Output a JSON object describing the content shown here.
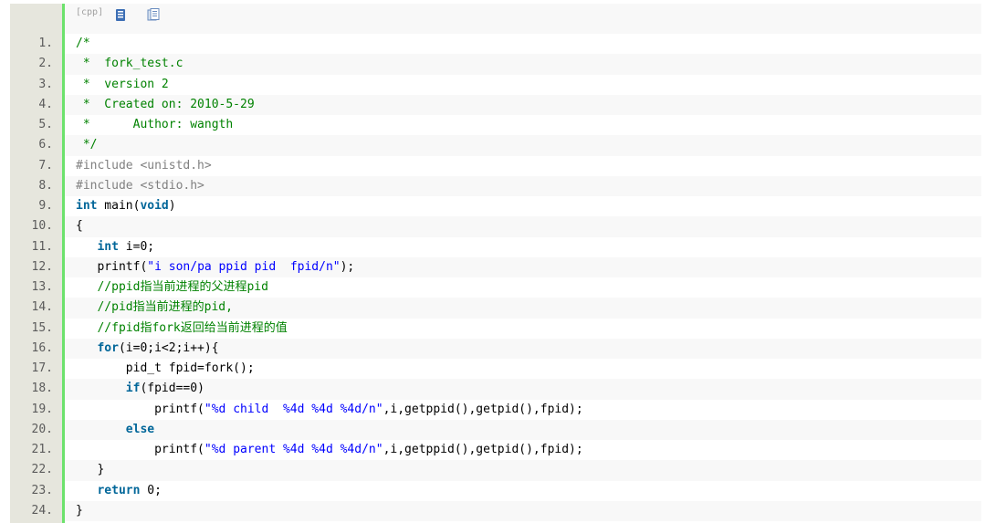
{
  "toolbar": {
    "language": "[cpp]",
    "view_icon": "view-source-icon",
    "copy_icon": "copy-to-clipboard-icon"
  },
  "colors": {
    "gutter": "#e6e6dd",
    "accent_bar": "#6ce26c",
    "comment": "#008200",
    "keyword": "#006699",
    "string": "#0000ff",
    "preprocessor": "#808080"
  },
  "lines": [
    {
      "num": "1.",
      "tokens": [
        {
          "t": "/*",
          "c": "comment"
        }
      ]
    },
    {
      "num": "2.",
      "tokens": [
        {
          "t": " *  fork_test.c",
          "c": "comment"
        }
      ]
    },
    {
      "num": "3.",
      "tokens": [
        {
          "t": " *  version 2",
          "c": "comment"
        }
      ]
    },
    {
      "num": "4.",
      "tokens": [
        {
          "t": " *  Created on: 2010-5-29",
          "c": "comment"
        }
      ]
    },
    {
      "num": "5.",
      "tokens": [
        {
          "t": " *      Author: wangth",
          "c": "comment"
        }
      ]
    },
    {
      "num": "6.",
      "tokens": [
        {
          "t": " */",
          "c": "comment"
        }
      ]
    },
    {
      "num": "7.",
      "tokens": [
        {
          "t": "#include <unistd.h>",
          "c": "pre"
        }
      ]
    },
    {
      "num": "8.",
      "tokens": [
        {
          "t": "#include <stdio.h>",
          "c": "pre"
        }
      ]
    },
    {
      "num": "9.",
      "tokens": [
        {
          "t": "int",
          "c": "kw"
        },
        {
          "t": " main(",
          "c": "plain"
        },
        {
          "t": "void",
          "c": "kw"
        },
        {
          "t": ")",
          "c": "plain"
        }
      ]
    },
    {
      "num": "10.",
      "tokens": [
        {
          "t": "{",
          "c": "plain"
        }
      ]
    },
    {
      "num": "11.",
      "tokens": [
        {
          "t": "   ",
          "c": "plain"
        },
        {
          "t": "int",
          "c": "kw"
        },
        {
          "t": " i=0;",
          "c": "plain"
        }
      ]
    },
    {
      "num": "12.",
      "tokens": [
        {
          "t": "   printf(",
          "c": "plain"
        },
        {
          "t": "\"i son/pa ppid pid  fpid/n\"",
          "c": "str"
        },
        {
          "t": ");",
          "c": "plain"
        }
      ]
    },
    {
      "num": "13.",
      "tokens": [
        {
          "t": "   ",
          "c": "plain"
        },
        {
          "t": "//ppid指当前进程的父进程pid",
          "c": "comment"
        }
      ]
    },
    {
      "num": "14.",
      "tokens": [
        {
          "t": "   ",
          "c": "plain"
        },
        {
          "t": "//pid指当前进程的pid,",
          "c": "comment"
        }
      ]
    },
    {
      "num": "15.",
      "tokens": [
        {
          "t": "   ",
          "c": "plain"
        },
        {
          "t": "//fpid指fork返回给当前进程的值",
          "c": "comment"
        }
      ]
    },
    {
      "num": "16.",
      "tokens": [
        {
          "t": "   ",
          "c": "plain"
        },
        {
          "t": "for",
          "c": "kw"
        },
        {
          "t": "(i=0;i<2;i++){",
          "c": "plain"
        }
      ]
    },
    {
      "num": "17.",
      "tokens": [
        {
          "t": "       pid_t fpid=fork();",
          "c": "plain"
        }
      ]
    },
    {
      "num": "18.",
      "tokens": [
        {
          "t": "       ",
          "c": "plain"
        },
        {
          "t": "if",
          "c": "kw"
        },
        {
          "t": "(fpid==0)",
          "c": "plain"
        }
      ]
    },
    {
      "num": "19.",
      "tokens": [
        {
          "t": "           printf(",
          "c": "plain"
        },
        {
          "t": "\"%d child  %4d %4d %4d/n\"",
          "c": "str"
        },
        {
          "t": ",i,getppid(),getpid(),fpid);",
          "c": "plain"
        }
      ]
    },
    {
      "num": "20.",
      "tokens": [
        {
          "t": "       ",
          "c": "plain"
        },
        {
          "t": "else",
          "c": "kw"
        }
      ]
    },
    {
      "num": "21.",
      "tokens": [
        {
          "t": "           printf(",
          "c": "plain"
        },
        {
          "t": "\"%d parent %4d %4d %4d/n\"",
          "c": "str"
        },
        {
          "t": ",i,getppid(),getpid(),fpid);",
          "c": "plain"
        }
      ]
    },
    {
      "num": "22.",
      "tokens": [
        {
          "t": "   }",
          "c": "plain"
        }
      ]
    },
    {
      "num": "23.",
      "tokens": [
        {
          "t": "   ",
          "c": "plain"
        },
        {
          "t": "return",
          "c": "kw"
        },
        {
          "t": " 0;",
          "c": "plain"
        }
      ]
    },
    {
      "num": "24.",
      "tokens": [
        {
          "t": "}",
          "c": "plain"
        }
      ]
    }
  ]
}
